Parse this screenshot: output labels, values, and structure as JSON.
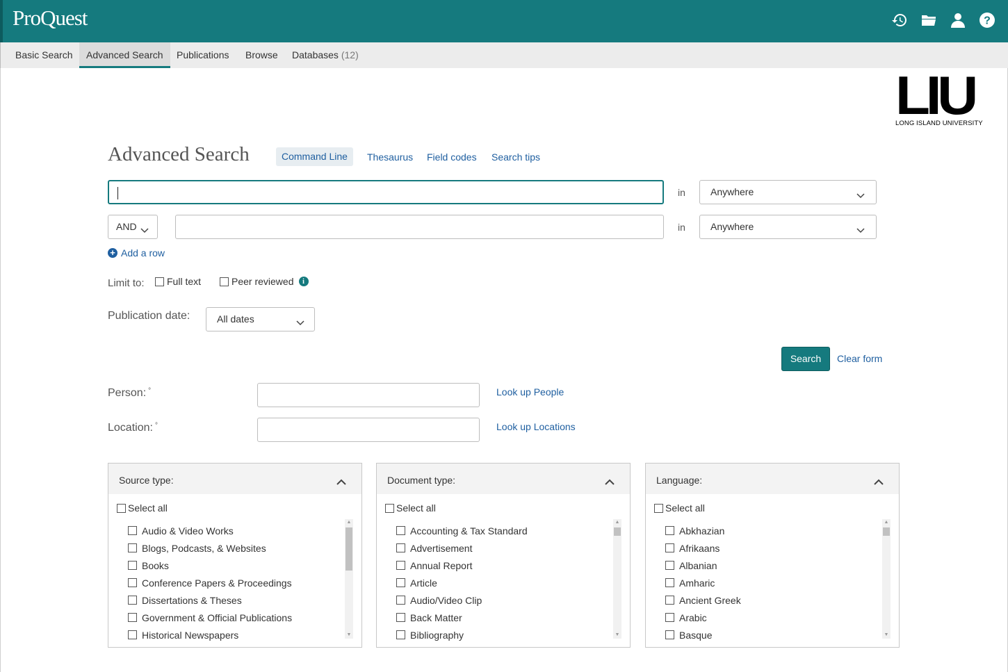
{
  "header": {
    "brand": "ProQuest",
    "icons": [
      "history-icon",
      "folder-icon",
      "user-icon",
      "help-icon"
    ]
  },
  "nav": {
    "tabs": [
      {
        "label": "Basic Search",
        "active": false
      },
      {
        "label": "Advanced Search",
        "active": true
      },
      {
        "label": "Publications",
        "active": false
      },
      {
        "label": "Browse",
        "active": false
      },
      {
        "label": "Databases",
        "count": "(12)",
        "active": false
      }
    ]
  },
  "logo": {
    "mark": "LIU",
    "subtitle": "LONG ISLAND UNIVERSITY"
  },
  "page": {
    "title": "Advanced Search",
    "command_line": "Command Line",
    "links": [
      "Thesaurus",
      "Field codes",
      "Search tips"
    ]
  },
  "search_rows": [
    {
      "value": "",
      "in_label": "in",
      "field": "Anywhere"
    },
    {
      "operator": "AND",
      "value": "",
      "in_label": "in",
      "field": "Anywhere"
    }
  ],
  "add_row": "Add a row",
  "limit": {
    "label": "Limit to:",
    "full_text": "Full text",
    "peer_reviewed": "Peer reviewed"
  },
  "pub_date": {
    "label": "Publication date:",
    "value": "All dates"
  },
  "actions": {
    "search": "Search",
    "clear": "Clear form"
  },
  "person": {
    "label": "Person:",
    "marker": "°",
    "value": "",
    "lookup": "Look up People"
  },
  "location": {
    "label": "Location:",
    "marker": "°",
    "value": "",
    "lookup": "Look up Locations"
  },
  "facets": {
    "source_type": {
      "title": "Source type:",
      "select_all": "Select all",
      "items": [
        "Audio & Video Works",
        "Blogs, Podcasts, & Websites",
        "Books",
        "Conference Papers & Proceedings",
        "Dissertations & Theses",
        "Government & Official Publications",
        "Historical Newspapers"
      ]
    },
    "document_type": {
      "title": "Document type:",
      "select_all": "Select all",
      "items": [
        "Accounting & Tax Standard",
        "Advertisement",
        "Annual Report",
        "Article",
        "Audio/Video Clip",
        "Back Matter",
        "Bibliography"
      ]
    },
    "language": {
      "title": "Language:",
      "select_all": "Select all",
      "items": [
        "Abkhazian",
        "Afrikaans",
        "Albanian",
        "Amharic",
        "Ancient Greek",
        "Arabic",
        "Basque"
      ]
    }
  }
}
